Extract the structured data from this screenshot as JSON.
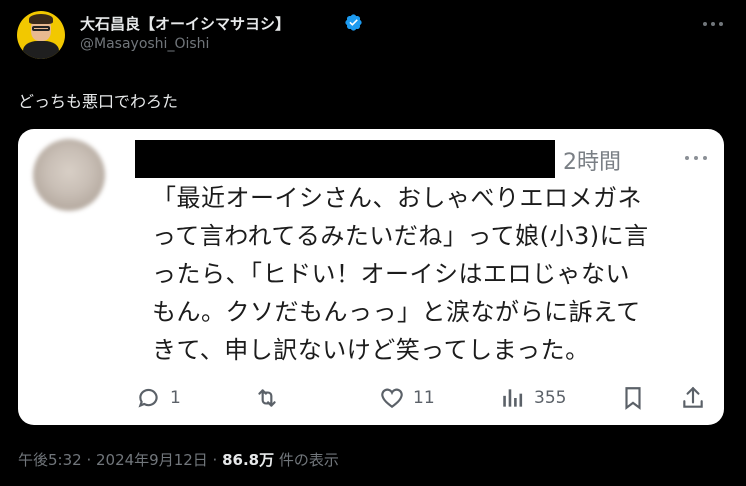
{
  "author": {
    "display_name": "大石昌良【オーイシマサヨシ】",
    "handle": "@Masayoshi_Oishi",
    "verified": true,
    "verified_color": "#1d9bf0"
  },
  "tweet": {
    "text": "どっちも悪口でわろた"
  },
  "quoted": {
    "time": "2時間",
    "lines": [
      "「最近オーイシさん、おしゃべりエロメガネ",
      "って言われてるみたいだね」って娘(小3)に言",
      "ったら、「ヒドい！オーイシはエロじゃない",
      "もん。クソだもんっっ」と涙ながらに訴えて",
      "きて、申し訳ないけど笑ってしまった。"
    ],
    "actions": {
      "reply_count": "1",
      "like_count": "11",
      "views_count": "355"
    }
  },
  "meta": {
    "timestamp": "午後5:32 · 2024年9月12日 · ",
    "views": "86.8万",
    "views_suffix": " 件の表示"
  }
}
